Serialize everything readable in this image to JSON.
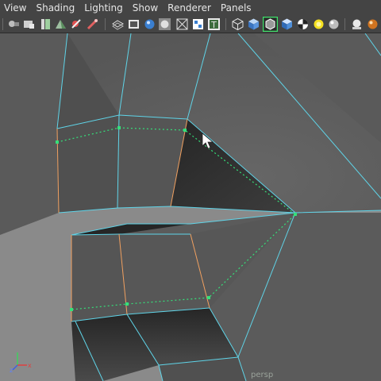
{
  "menubar": {
    "items": [
      {
        "label": "View"
      },
      {
        "label": "Shading"
      },
      {
        "label": "Lighting"
      },
      {
        "label": "Show"
      },
      {
        "label": "Renderer"
      },
      {
        "label": "Panels"
      }
    ]
  },
  "toolbar": {
    "icons": [
      "select-camera-icon",
      "camera-attributes-icon",
      "bookmarks-icon",
      "image-plane-icon",
      "grid-icon",
      "film-gate-icon",
      "wireframe-icon",
      "resolution-gate-icon",
      "smooth-shade-icon",
      "flat-shade-icon",
      "xray-icon",
      "component-icon",
      "texture-icon",
      "wireframe-cube-icon",
      "shaded-cube-icon",
      "wireframe-on-shaded-icon",
      "checker-icon",
      "default-light-icon",
      "lights-sphere-icon",
      "hud-icon",
      "render-sphere-icon"
    ]
  },
  "viewport": {
    "camera_label": "persp",
    "axis": {
      "x": "x",
      "z": "z"
    }
  },
  "colors": {
    "background": "#5a5a5a",
    "menubar": "#444444",
    "wire": "#5fd4e8",
    "highlight_edge": "#f0a060",
    "selection_path": "#35e07a"
  }
}
